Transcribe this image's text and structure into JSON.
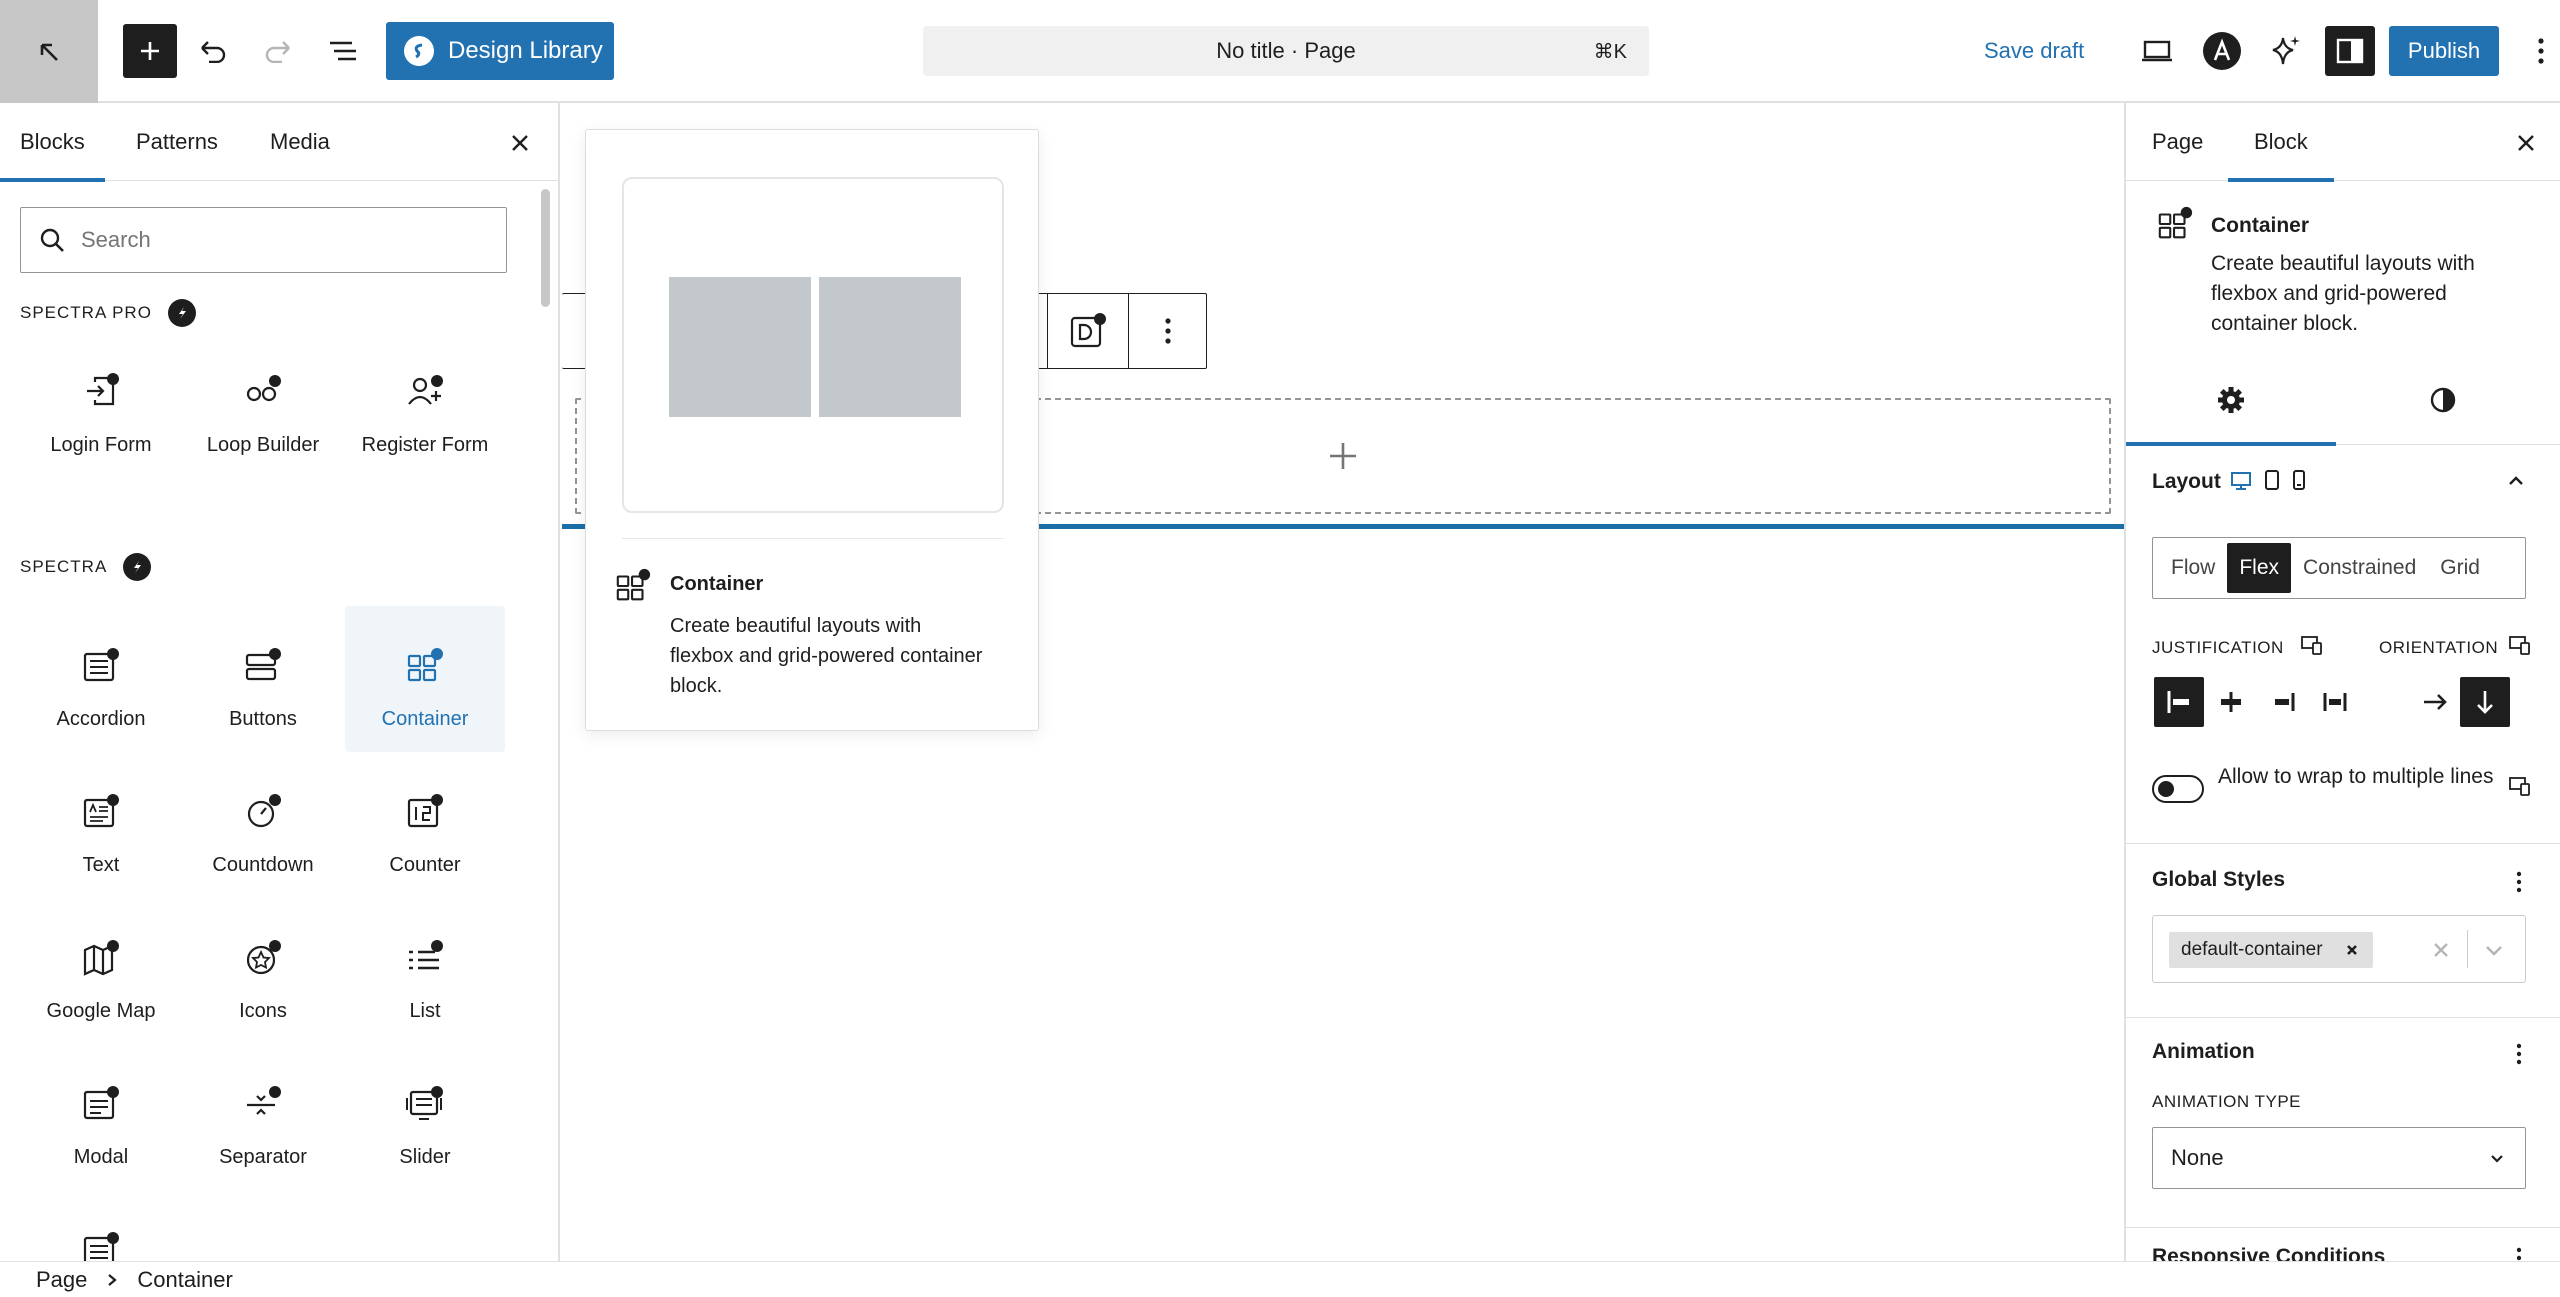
{
  "header": {
    "design_library": "Design Library",
    "command_title": "No title · Page",
    "command_shortcut": "⌘K",
    "save_draft": "Save draft",
    "publish": "Publish"
  },
  "inserter": {
    "tabs": [
      "Blocks",
      "Patterns",
      "Media"
    ],
    "active_tab": "Blocks",
    "search_placeholder": "Search",
    "sections": [
      {
        "title": "SPECTRA PRO",
        "blocks": [
          "Login Form",
          "Loop Builder",
          "Register Form"
        ]
      },
      {
        "title": "SPECTRA",
        "blocks": [
          "Accordion",
          "Buttons",
          "Container",
          "Text",
          "Countdown",
          "Counter",
          "Google Map",
          "Icons",
          "List",
          "Modal",
          "Separator",
          "Slider"
        ]
      }
    ],
    "selected_block": "Container"
  },
  "preview": {
    "title": "Container",
    "description": "Create beautiful layouts with flexbox and grid-powered container block."
  },
  "settings": {
    "tabs": [
      "Page",
      "Block"
    ],
    "active_tab": "Block",
    "block_title": "Container",
    "block_description": "Create beautiful layouts with flexbox and grid-powered container block.",
    "layout_label": "Layout",
    "layout_options": [
      "Flow",
      "Flex",
      "Constrained",
      "Grid"
    ],
    "layout_selected": "Flex",
    "justification_label": "JUSTIFICATION",
    "orientation_label": "ORIENTATION",
    "wrap_label": "Allow to wrap to multiple lines",
    "global_styles_label": "Global Styles",
    "global_style_token": "default-container",
    "animation_label": "Animation",
    "animation_type_label": "ANIMATION TYPE",
    "animation_type_value": "None",
    "responsive_label": "Responsive Conditions"
  },
  "breadcrumb": [
    "Page",
    "Container"
  ],
  "colors": {
    "accent": "#2271b1",
    "dark": "#1e1e1e",
    "selected_bg": "#f0f5fa"
  }
}
